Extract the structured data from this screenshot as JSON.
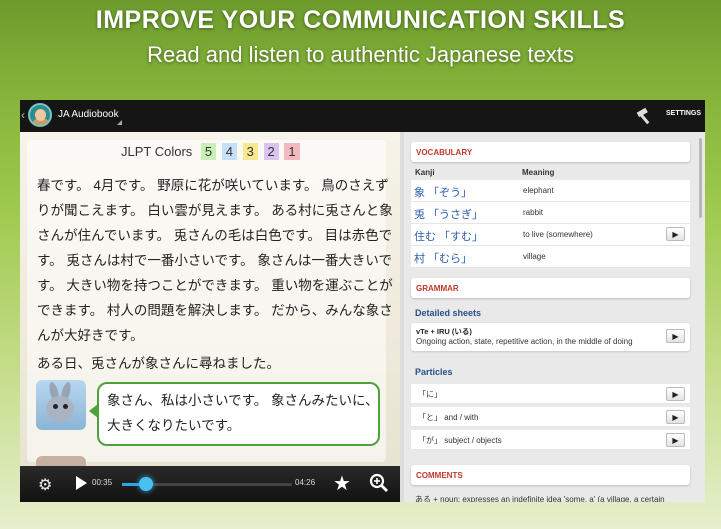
{
  "banner": {
    "headline": "IMPROVE YOUR COMMUNICATION SKILLS",
    "subline": "Read and listen to authentic Japanese texts"
  },
  "app": {
    "title": "JA Audiobook",
    "settings_label": "SETTINGS"
  },
  "reader": {
    "legend_label": "JLPT Colors",
    "legend": [
      {
        "level": "5",
        "color": "#c8f0b4"
      },
      {
        "level": "4",
        "color": "#c6e0f8"
      },
      {
        "level": "3",
        "color": "#f8e890"
      },
      {
        "level": "2",
        "color": "#dcc4f0"
      },
      {
        "level": "1",
        "color": "#f4b8c0"
      }
    ],
    "paragraph": [
      "春です。 4月です。 野原に花が咲いています。 鳥のさえず",
      "りが聞こえます。 白い雲が見えます。 ある村に兎さんと象",
      "さんが住んでいます。 兎さんの毛は白色です。 目は赤色で",
      "す。 兎さんは村で一番小さいです。 象さんは一番大きいで",
      "す。 大きい物を持つことができます。 重い物を運ぶことが",
      "できます。 村人の問題を解決します。 だから、みんな象さ",
      "んが大好きです。"
    ],
    "sentence2": "ある日、兎さんが象さんに尋ねました。",
    "bubble": [
      "象さん、私は小さいです。 象さんみたいに、",
      "大きくなりたいです。"
    ]
  },
  "player": {
    "current_time": "00:35",
    "total_time": "04:26",
    "progress": 0.14
  },
  "vocabulary": {
    "header": "VOCABULARY",
    "col_kanji": "Kanji",
    "col_meaning": "Meaning",
    "rows": [
      {
        "kanji": "象 「ぞう」",
        "meaning": "elephant",
        "has_arrow": false
      },
      {
        "kanji": "兎 「うさぎ」",
        "meaning": "rabbit",
        "has_arrow": false
      },
      {
        "kanji": "住む 「すむ」",
        "meaning": "to live (somewhere)",
        "has_arrow": true
      },
      {
        "kanji": "村 「むら」",
        "meaning": "village",
        "has_arrow": false
      }
    ]
  },
  "grammar": {
    "header": "GRAMMAR",
    "detailed_title": "Detailed sheets",
    "sheet_name": "vTe + IRU (いる)",
    "sheet_desc": "Ongoing action, state, repetitive action, in the middle of doing",
    "particles_title": "Particles",
    "particles": [
      "「に」",
      "「と」 and / with",
      "「が」 subject / objects"
    ]
  },
  "comments": {
    "header": "COMMENTS",
    "text": "ある + noun: expresses an indefinite idea 'some, a' (a village, a certain"
  }
}
